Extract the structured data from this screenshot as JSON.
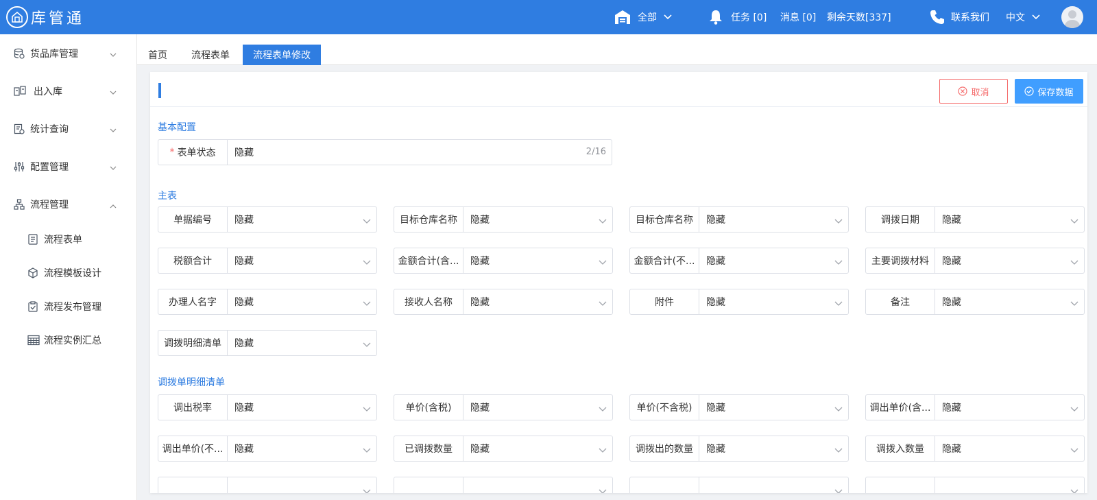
{
  "header": {
    "logo_text": "库管通",
    "scope_label": "全部",
    "tasks_label": "任务 [0]",
    "messages_label": "消息 [0]",
    "days_left_label": "剩余天数[337]",
    "contact_label": "联系我们",
    "language_label": "中文",
    "brand_color": "#2f7de1"
  },
  "sidebar": {
    "items": [
      {
        "label": "货品库管理",
        "icon": "database-icon",
        "expanded": false
      },
      {
        "label": "出入库",
        "icon": "transfer-icon",
        "expanded": false
      },
      {
        "label": "统计查询",
        "icon": "report-icon",
        "expanded": false
      },
      {
        "label": "配置管理",
        "icon": "sliders-icon",
        "expanded": false
      },
      {
        "label": "流程管理",
        "icon": "flow-icon",
        "expanded": true
      }
    ],
    "sub_items": [
      {
        "label": "流程表单",
        "icon": "document-icon"
      },
      {
        "label": "流程模板设计",
        "icon": "cube-icon"
      },
      {
        "label": "流程发布管理",
        "icon": "clipboard-check-icon"
      },
      {
        "label": "流程实例汇总",
        "icon": "calendar-grid-icon"
      }
    ]
  },
  "tabs": [
    {
      "label": "首页",
      "active": false
    },
    {
      "label": "流程表单",
      "active": false
    },
    {
      "label": "流程表单修改",
      "active": true
    }
  ],
  "actions": {
    "cancel_label": "取消",
    "save_label": "保存数据"
  },
  "sections": {
    "basic": {
      "title": "基本配置",
      "field": {
        "label": "表单状态",
        "required_mark": "*",
        "value": "隐藏",
        "count": "2/16"
      }
    },
    "main": {
      "title": "主表",
      "fields": [
        {
          "label": "单据编号",
          "value": "隐藏"
        },
        {
          "label": "目标仓库名称",
          "value": "隐藏"
        },
        {
          "label": "目标仓库名称",
          "value": "隐藏"
        },
        {
          "label": "调拨日期",
          "value": "隐藏"
        },
        {
          "label": "税额合计",
          "value": "隐藏"
        },
        {
          "label": "金额合计(含...",
          "value": "隐藏"
        },
        {
          "label": "金额合计(不...",
          "value": "隐藏"
        },
        {
          "label": "主要调拨材料",
          "value": "隐藏"
        },
        {
          "label": "办理人名字",
          "value": "隐藏"
        },
        {
          "label": "接收人名称",
          "value": "隐藏"
        },
        {
          "label": "附件",
          "value": "隐藏"
        },
        {
          "label": "备注",
          "value": "隐藏"
        },
        {
          "label": "调拨明细清单",
          "value": "隐藏"
        }
      ]
    },
    "detail": {
      "title": "调拨单明细清单",
      "fields": [
        {
          "label": "调出税率",
          "value": "隐藏"
        },
        {
          "label": "单价(含税)",
          "value": "隐藏"
        },
        {
          "label": "单价(不含税)",
          "value": "隐藏"
        },
        {
          "label": "调出单价(含...",
          "value": "隐藏"
        },
        {
          "label": "调出单价(不...",
          "value": "隐藏"
        },
        {
          "label": "已调拨数量",
          "value": "隐藏"
        },
        {
          "label": "调拨出的数量",
          "value": "隐藏"
        },
        {
          "label": "调拨入数量",
          "value": "隐藏"
        }
      ]
    }
  }
}
